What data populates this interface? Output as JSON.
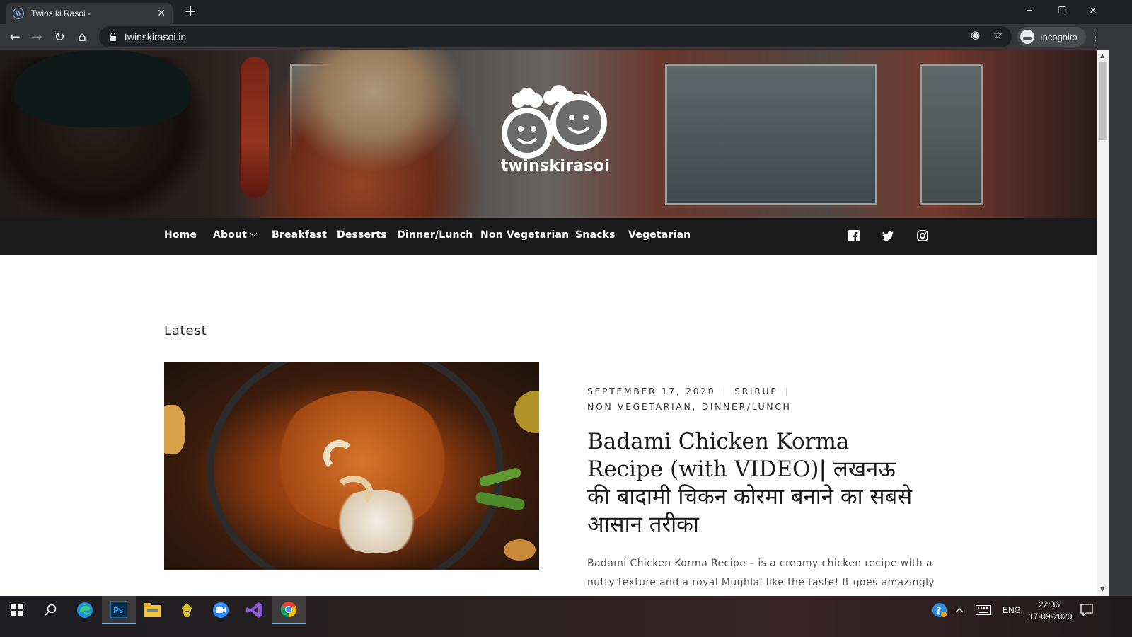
{
  "browser": {
    "tab_title": "Twins ki Rasoi -",
    "url": "twinskirasoi.in",
    "profile_label": "Incognito"
  },
  "site": {
    "brand": "twinskirasoi",
    "nav": [
      "Home",
      "About",
      "Breakfast",
      "Desserts",
      "Dinner/Lunch",
      "Non Vegetarian",
      "Snacks",
      "Vegetarian"
    ],
    "social": [
      "facebook-icon",
      "twitter-icon",
      "instagram-icon"
    ]
  },
  "content": {
    "section_title": "Latest",
    "post": {
      "date": "SEPTEMBER 17, 2020",
      "author": "SRIRUP",
      "categories": "NON VEGETARIAN, DINNER/LUNCH",
      "title": "Badami Chicken Korma Recipe (with VIDEO)| लखनऊ की बादामी चिकन कोरमा बनाने का सबसे आसान तरीका",
      "excerpt": "Badami Chicken Korma Recipe – is a creamy chicken recipe with a nutty texture and a royal Mughlai like the taste! It goes amazingly"
    }
  },
  "taskbar": {
    "language": "ENG",
    "time": "22:36",
    "date": "17-09-2020",
    "apps": [
      "windows-start",
      "search",
      "edge",
      "photoshop",
      "file-explorer",
      "app",
      "zoom",
      "visual-studio",
      "chrome"
    ]
  }
}
